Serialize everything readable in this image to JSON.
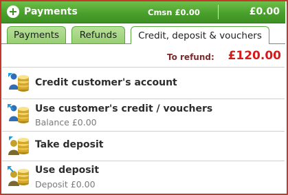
{
  "header": {
    "title": "Payments",
    "commission": "Cmsn £0.00",
    "total": "£0.00"
  },
  "tabs": [
    {
      "label": "Payments",
      "active": false
    },
    {
      "label": "Refunds",
      "active": false
    },
    {
      "label": "Credit, deposit & vouchers",
      "active": true
    }
  ],
  "refund": {
    "label": "To refund:",
    "amount": "£120.00"
  },
  "actions": [
    {
      "title": "Credit customer's account",
      "subtitle": "",
      "icon": "credit-account-icon"
    },
    {
      "title": "Use customer's credit / vouchers",
      "subtitle": "Balance £0.00",
      "icon": "use-credit-icon"
    },
    {
      "title": "Take deposit",
      "subtitle": "",
      "icon": "take-deposit-icon"
    },
    {
      "title": "Use deposit",
      "subtitle": "Deposit £0.00",
      "icon": "use-deposit-icon"
    }
  ],
  "colors": {
    "header_green": "#4aa02c",
    "refund_red": "#d61a1a",
    "frame_red": "#c0392b"
  }
}
